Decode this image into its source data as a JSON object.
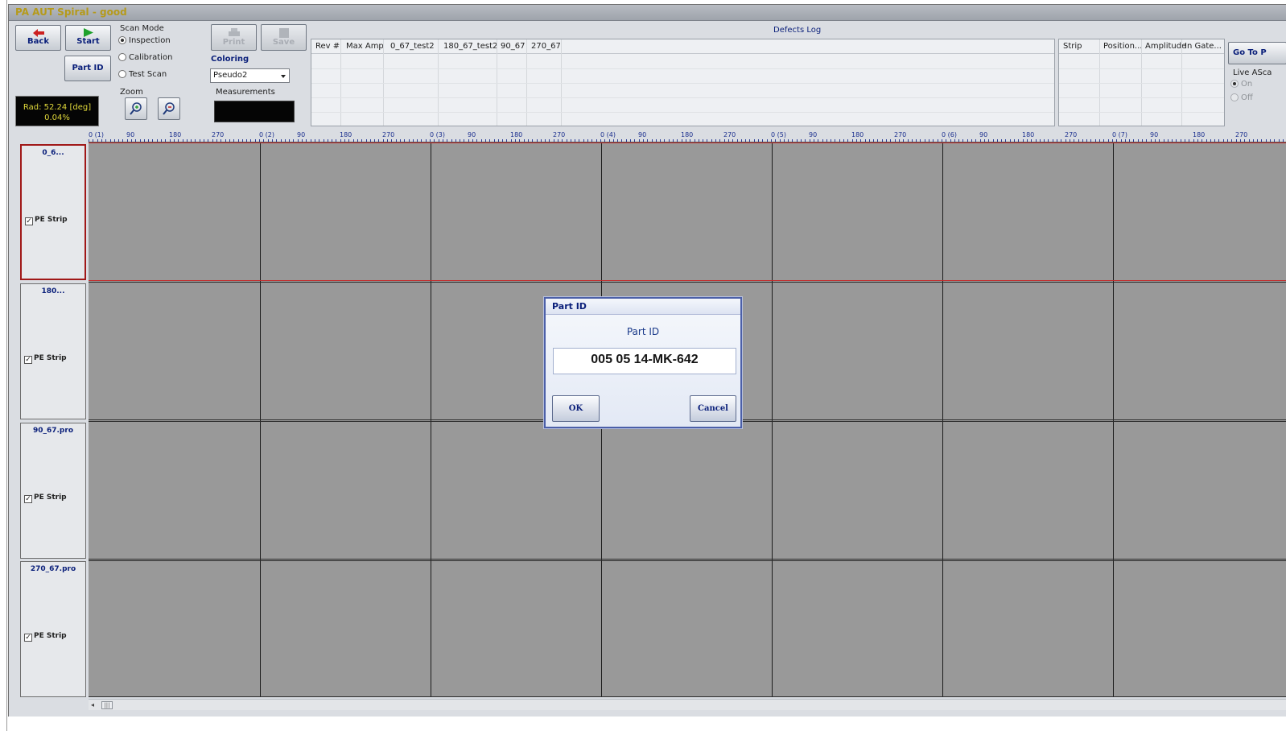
{
  "window": {
    "title": "PA AUT Spiral - good"
  },
  "toolbar": {
    "back_label": "Back",
    "start_label": "Start",
    "part_id_label": "Part ID",
    "print_label": "Print",
    "save_label": "Save",
    "go_to_label": "Go To P"
  },
  "scan_mode": {
    "label": "Scan Mode",
    "options": [
      "Inspection",
      "Calibration",
      "Test Scan"
    ],
    "selected": "Inspection"
  },
  "coloring": {
    "label": "Coloring",
    "value": "Pseudo2"
  },
  "zoom": {
    "label": "Zoom"
  },
  "measurements": {
    "label": "Measurements"
  },
  "status": {
    "line1": "Rad: 52.24 [deg]",
    "line2": "0.04%"
  },
  "defects_log": {
    "title": "Defects Log",
    "columns": [
      "Rev #",
      "Max Amp",
      "0_67_test2",
      "180_67_test2",
      "90_67",
      "270_67"
    ]
  },
  "strip_table": {
    "columns": [
      "Strip",
      "Position...",
      "Amplitude",
      "In Gate..."
    ]
  },
  "live_ascan": {
    "label": "Live ASca",
    "options": [
      "On",
      "Off"
    ],
    "selected": "On"
  },
  "ruler": {
    "labels": [
      "0 (1)",
      "90",
      "180",
      "270",
      "0 (2)",
      "90",
      "180",
      "270",
      "0 (3)",
      "90",
      "180",
      "270",
      "0 (4)",
      "90",
      "180",
      "270",
      "0 (5)",
      "90",
      "180",
      "270",
      "0 (6)",
      "90",
      "180",
      "270",
      "0 (7)",
      "90",
      "180",
      "270"
    ]
  },
  "strips": [
    {
      "name": "0_6...",
      "checkbox_label": "PE Strip",
      "checked": true
    },
    {
      "name": "180...",
      "checkbox_label": "PE Strip",
      "checked": true
    },
    {
      "name": "90_67.pro",
      "checkbox_label": "PE Strip",
      "checked": true
    },
    {
      "name": "270_67.pro",
      "checkbox_label": "PE Strip",
      "checked": true
    }
  ],
  "dialog": {
    "title": "Part ID",
    "prompt": "Part ID",
    "value": "005 05 14-MK-642",
    "ok_label": "OK",
    "cancel_label": "Cancel"
  },
  "colors": {
    "accent": "#0a1f7a",
    "title_text": "#b59a1a",
    "status_text": "#e0d83a",
    "scan_background": "#999999",
    "active_strip": "#c42a2a"
  }
}
